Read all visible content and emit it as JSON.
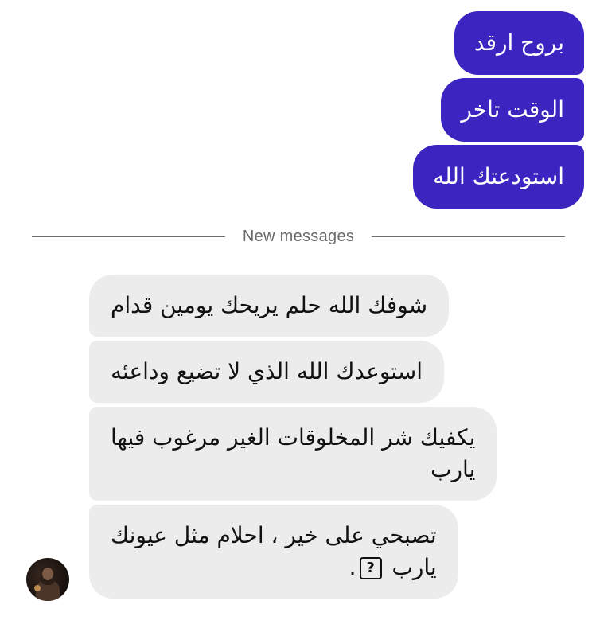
{
  "outgoing_messages": [
    {
      "text": "بروح ارقد"
    },
    {
      "text": "الوقت تاخر"
    },
    {
      "text": "استودعتك الله"
    }
  ],
  "divider": {
    "label": "New messages"
  },
  "incoming_messages": [
    {
      "lines": [
        "شوفك الله حلم يريحك يومين قدام"
      ]
    },
    {
      "lines": [
        "استوعدك الله الذي لا تضيع وداعئه"
      ]
    },
    {
      "lines": [
        "يكفيك شر المخلوقات الغير مرغوب فيها",
        "يارب"
      ]
    },
    {
      "lines": [
        "تصبحي على خير ، احلام مثل عيونك",
        "يارب"
      ],
      "emoji": "?",
      "trailing": "."
    }
  ],
  "avatar": {
    "icon": "profile-photo"
  },
  "colors": {
    "outgoing_bubble": "#3b25c1",
    "incoming_bubble": "#ececec",
    "divider_text": "#6a6a6a"
  }
}
